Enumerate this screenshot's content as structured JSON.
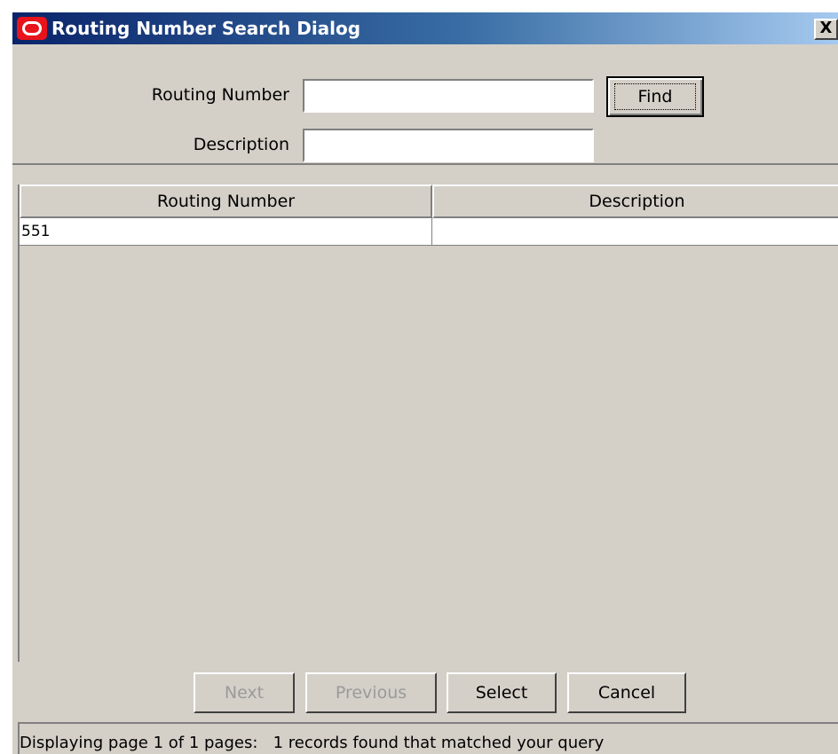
{
  "window": {
    "title": "Routing Number Search Dialog",
    "close_label": "X",
    "logo_icon": "oracle-logo-icon"
  },
  "search": {
    "routing_number_label": "Routing Number",
    "routing_number_value": "",
    "description_label": "Description",
    "description_value": "",
    "find_label": "Find"
  },
  "table": {
    "columns": [
      "Routing Number",
      "Description"
    ],
    "rows": [
      {
        "routing_number": "551",
        "description": ""
      }
    ]
  },
  "buttons": {
    "next": "Next",
    "previous": "Previous",
    "select": "Select",
    "cancel": "Cancel"
  },
  "status": {
    "text": "Displaying page 1 of 1 pages:   1 records found that matched your query"
  },
  "colors": {
    "titlebar_start": "#0a246a",
    "titlebar_end": "#a6caf0",
    "dialog_bg": "#d4d0c8",
    "logo": "#e8131b"
  }
}
